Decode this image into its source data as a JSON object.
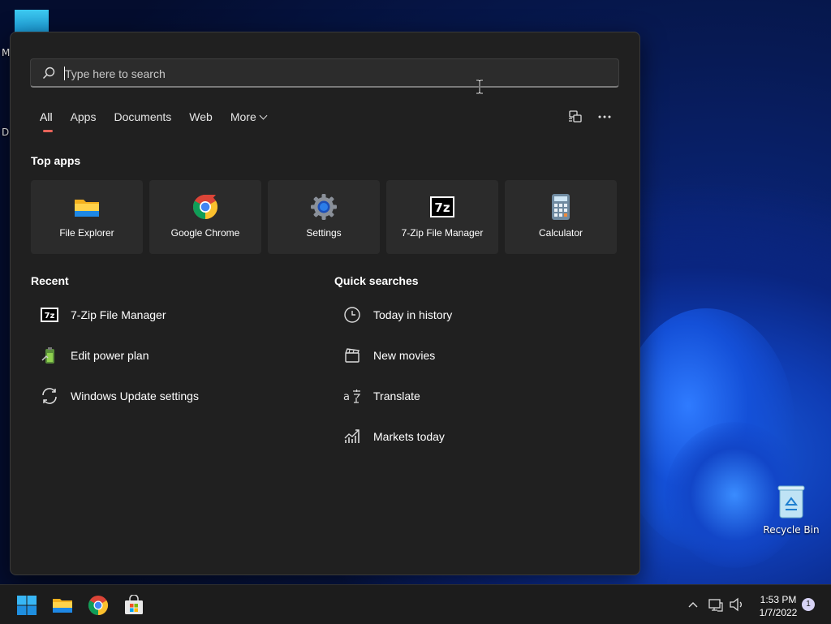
{
  "desktop": {
    "partial_labels": [
      "M",
      "Da"
    ],
    "recycle_bin": "Recycle Bin"
  },
  "search": {
    "placeholder": "Type here to search",
    "tabs": [
      "All",
      "Apps",
      "Documents",
      "Web",
      "More"
    ],
    "active_tab": "All"
  },
  "top_apps": {
    "heading": "Top apps",
    "items": [
      {
        "label": "File Explorer",
        "icon": "folder-icon"
      },
      {
        "label": "Google Chrome",
        "icon": "chrome-icon"
      },
      {
        "label": "Settings",
        "icon": "gear-icon"
      },
      {
        "label": "7-Zip File Manager",
        "icon": "7zip-icon"
      },
      {
        "label": "Calculator",
        "icon": "calculator-icon"
      }
    ]
  },
  "recent": {
    "heading": "Recent",
    "items": [
      {
        "label": "7-Zip File Manager",
        "icon": "7zip-icon"
      },
      {
        "label": "Edit power plan",
        "icon": "battery-icon"
      },
      {
        "label": "Windows Update settings",
        "icon": "refresh-icon"
      }
    ]
  },
  "quick_searches": {
    "heading": "Quick searches",
    "items": [
      {
        "label": "Today in history",
        "icon": "clock-icon"
      },
      {
        "label": "New movies",
        "icon": "clapperboard-icon"
      },
      {
        "label": "Translate",
        "icon": "translate-icon"
      },
      {
        "label": "Markets today",
        "icon": "chart-icon"
      }
    ]
  },
  "taskbar": {
    "time": "1:53 PM",
    "date": "1/7/2022",
    "notification_count": "1"
  },
  "colors": {
    "panel_bg": "#202020",
    "tile_bg": "#2b2b2b",
    "active_tab_indicator": "#e8645a",
    "accent_blue": "#0078d4"
  }
}
